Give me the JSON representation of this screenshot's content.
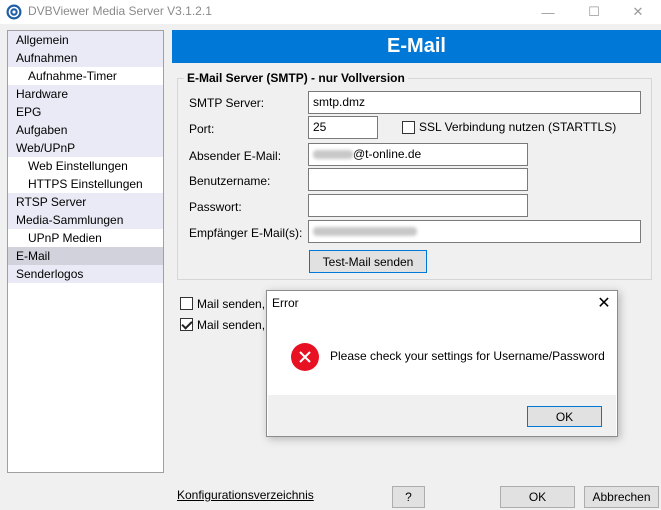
{
  "window": {
    "title": "DVBViewer Media Server V3.1.2.1",
    "app_icon": "dvbviewer-icon",
    "controls": {
      "minimize": "—",
      "maximize": "☐",
      "close": "✕"
    }
  },
  "nav": {
    "items": [
      {
        "label": "Allgemein",
        "level": 1,
        "selected": false
      },
      {
        "label": "Aufnahmen",
        "level": 1,
        "selected": false
      },
      {
        "label": "Aufnahme-Timer",
        "level": 2,
        "selected": false
      },
      {
        "label": "Hardware",
        "level": 1,
        "selected": false
      },
      {
        "label": "EPG",
        "level": 1,
        "selected": false
      },
      {
        "label": "Aufgaben",
        "level": 1,
        "selected": false
      },
      {
        "label": "Web/UPnP",
        "level": 1,
        "selected": false
      },
      {
        "label": "Web Einstellungen",
        "level": 2,
        "selected": false
      },
      {
        "label": "HTTPS Einstellungen",
        "level": 2,
        "selected": false
      },
      {
        "label": "RTSP Server",
        "level": 1,
        "selected": false
      },
      {
        "label": "Media-Sammlungen",
        "level": 1,
        "selected": false
      },
      {
        "label": "UPnP Medien",
        "level": 2,
        "selected": false
      },
      {
        "label": "E-Mail",
        "level": 1,
        "selected": true
      },
      {
        "label": "Senderlogos",
        "level": 1,
        "selected": false
      }
    ]
  },
  "header": {
    "title": "E-Mail"
  },
  "smtp": {
    "group_title": "E-Mail Server (SMTP) - nur Vollversion",
    "server_label": "SMTP Server:",
    "server_value": "smtp.dmz",
    "port_label": "Port:",
    "port_value": "25",
    "ssl_label": "SSL Verbindung nutzen (STARTTLS)",
    "ssl_checked": false,
    "sender_label": "Absender E-Mail:",
    "sender_value_suffix": "@t-online.de",
    "username_label": "Benutzername:",
    "username_value": "",
    "password_label": "Passwort:",
    "password_value": "",
    "recipient_label": "Empfänger E-Mail(s):",
    "test_button": "Test-Mail senden"
  },
  "options": [
    {
      "label": "Mail senden, ",
      "checked": false
    },
    {
      "label": "Mail senden, v",
      "checked": true
    }
  ],
  "footer": {
    "config_link": "Konfigurationsverzeichnis",
    "help_button": "?",
    "ok_button": "OK",
    "cancel_button": "Abbrechen"
  },
  "error_dialog": {
    "title": "Error",
    "close": "✕",
    "icon": "error-icon",
    "message": "Please check your settings for Username/Password",
    "ok_button": "OK"
  }
}
